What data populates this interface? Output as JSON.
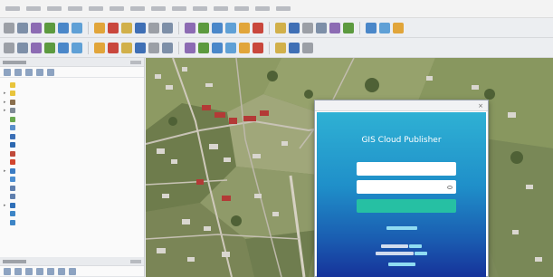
{
  "menubar": {
    "items": [
      "",
      "",
      "",
      "",
      "",
      "",
      "",
      "",
      "",
      "",
      "",
      "",
      "",
      ""
    ]
  },
  "toolbar1": {
    "icons": [
      "new-project-icon",
      "open-project-icon",
      "save-project-icon",
      "save-as-icon",
      "print-layout-icon",
      "layout-manager-icon",
      "pan-icon",
      "pan-to-selection-icon",
      "zoom-in-icon",
      "zoom-out-icon",
      "zoom-full-icon",
      "zoom-selection-icon",
      "zoom-layer-icon",
      "zoom-last-icon",
      "zoom-next-icon",
      "new-map-view-icon",
      "refresh-icon",
      "identify-icon",
      "select-icon",
      "deselect-icon",
      "attribute-table-icon",
      "field-calculator-icon",
      "statistics-icon",
      "toolbox-icon",
      "sum-icon",
      "annotation-icon",
      "measure-icon"
    ]
  },
  "toolbar2": {
    "icons": [
      "data-source-manager-icon",
      "new-layer-icon",
      "digitize-icon",
      "edit-pencil-icon",
      "save-edits-icon",
      "add-feature-icon",
      "vertex-tool-icon",
      "delete-icon",
      "cut-icon",
      "copy-icon",
      "paste-icon",
      "undo-icon",
      "redo-icon",
      "label-icon",
      "label-pin-icon",
      "label-show-icon",
      "label-move-icon",
      "label-rotate-icon",
      "label-change-icon",
      "python-icon",
      "plugin-icon"
    ]
  },
  "browser_panel": {
    "title": "",
    "items": [
      {
        "label": "",
        "icon": "star-icon",
        "color": "#e8c43c",
        "expand": ""
      },
      {
        "label": "",
        "icon": "star-icon",
        "color": "#e8c43c",
        "expand": "▸"
      },
      {
        "label": "",
        "icon": "home-icon",
        "color": "#8a6f4e",
        "expand": "▸"
      },
      {
        "label": "",
        "icon": "drive-icon",
        "color": "#7f8a96",
        "expand": "▸"
      },
      {
        "label": "",
        "icon": "geopackage-icon",
        "color": "#6aa84f",
        "expand": ""
      },
      {
        "label": "",
        "icon": "spatialite-icon",
        "color": "#5a8fcb",
        "expand": ""
      },
      {
        "label": "",
        "icon": "postgis-icon",
        "color": "#3b6fb6",
        "expand": ""
      },
      {
        "label": "",
        "icon": "sap-hana-icon",
        "color": "#2d68b0",
        "expand": ""
      },
      {
        "label": "",
        "icon": "mssql-icon",
        "color": "#c04a3a",
        "expand": ""
      },
      {
        "label": "",
        "icon": "oracle-icon",
        "color": "#d2452e",
        "expand": ""
      },
      {
        "label": "",
        "icon": "arcgis-icon",
        "color": "#3b7cc4",
        "expand": "▸"
      },
      {
        "label": "",
        "icon": "tiles-icon",
        "color": "#4c8ed1",
        "expand": ""
      },
      {
        "label": "",
        "icon": "vector-tiles-icon",
        "color": "#5f7fae",
        "expand": ""
      },
      {
        "label": "",
        "icon": "vector-tiles-icon",
        "color": "#5f7fae",
        "expand": ""
      },
      {
        "label": "",
        "icon": "xyz-tiles-icon",
        "color": "#2f6fb8",
        "expand": "▸"
      },
      {
        "label": "",
        "icon": "wcs-icon",
        "color": "#3d85c6",
        "expand": ""
      },
      {
        "label": "",
        "icon": "wfs-icon",
        "color": "#3d85c6",
        "expand": ""
      }
    ]
  },
  "layers_panel": {
    "title": ""
  },
  "dialog": {
    "window_title": "",
    "heading": "GIS Cloud Publisher",
    "username_placeholder": "",
    "password_placeholder": "",
    "login_label": "",
    "forgot_label": "",
    "line1_text": "",
    "line1_link": "",
    "line2_text": "",
    "line2_link": "",
    "line3_link": "",
    "colors": {
      "gradient_top": "#2fb1d4",
      "gradient_bottom": "#16339a",
      "login_button": "#26c0a3"
    }
  },
  "map": {}
}
